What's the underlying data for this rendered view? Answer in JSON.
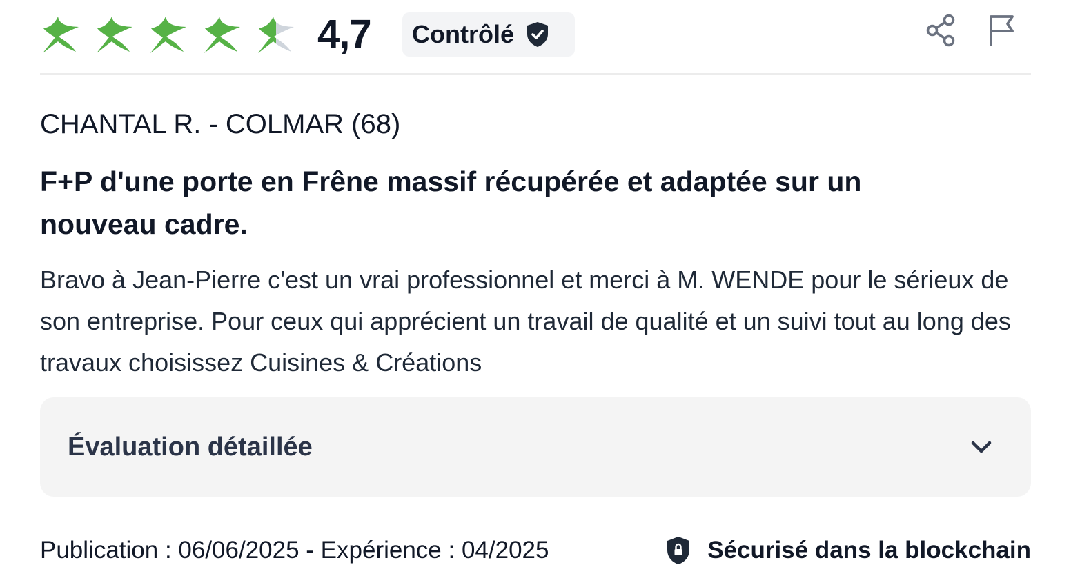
{
  "rating": {
    "value_text": "4,7",
    "value": 4.7,
    "max": 5,
    "full_stars": 4,
    "partial_star_fraction": 0.5,
    "star_color": "#56b246",
    "star_empty_color": "#cfd5dc"
  },
  "badge": {
    "label": "Contrôlé",
    "icon": "shield-check-icon",
    "color": "#1f2937"
  },
  "actions": {
    "share_icon": "share-icon",
    "report_icon": "flag-icon"
  },
  "review": {
    "author": "CHANTAL R. - COLMAR (68)",
    "title": "F+P d'une porte en Frêne massif récupérée et adaptée sur un nouveau cadre.",
    "body": "Bravo à Jean-Pierre c'est un vrai professionnel et merci à M. WENDE pour le sérieux de son entreprise. Pour ceux qui apprécient un travail de qualité et un suivi tout au long des travaux choisissez Cuisines & Créations"
  },
  "detailed_evaluation": {
    "label": "Évaluation détaillée",
    "icon": "chevron-down-icon",
    "expanded": false
  },
  "footer": {
    "meta": "Publication : 06/06/2025 - Expérience : 04/2025",
    "secure_label": "Sécurisé dans la blockchain",
    "secure_icon": "lock-shield-icon"
  }
}
